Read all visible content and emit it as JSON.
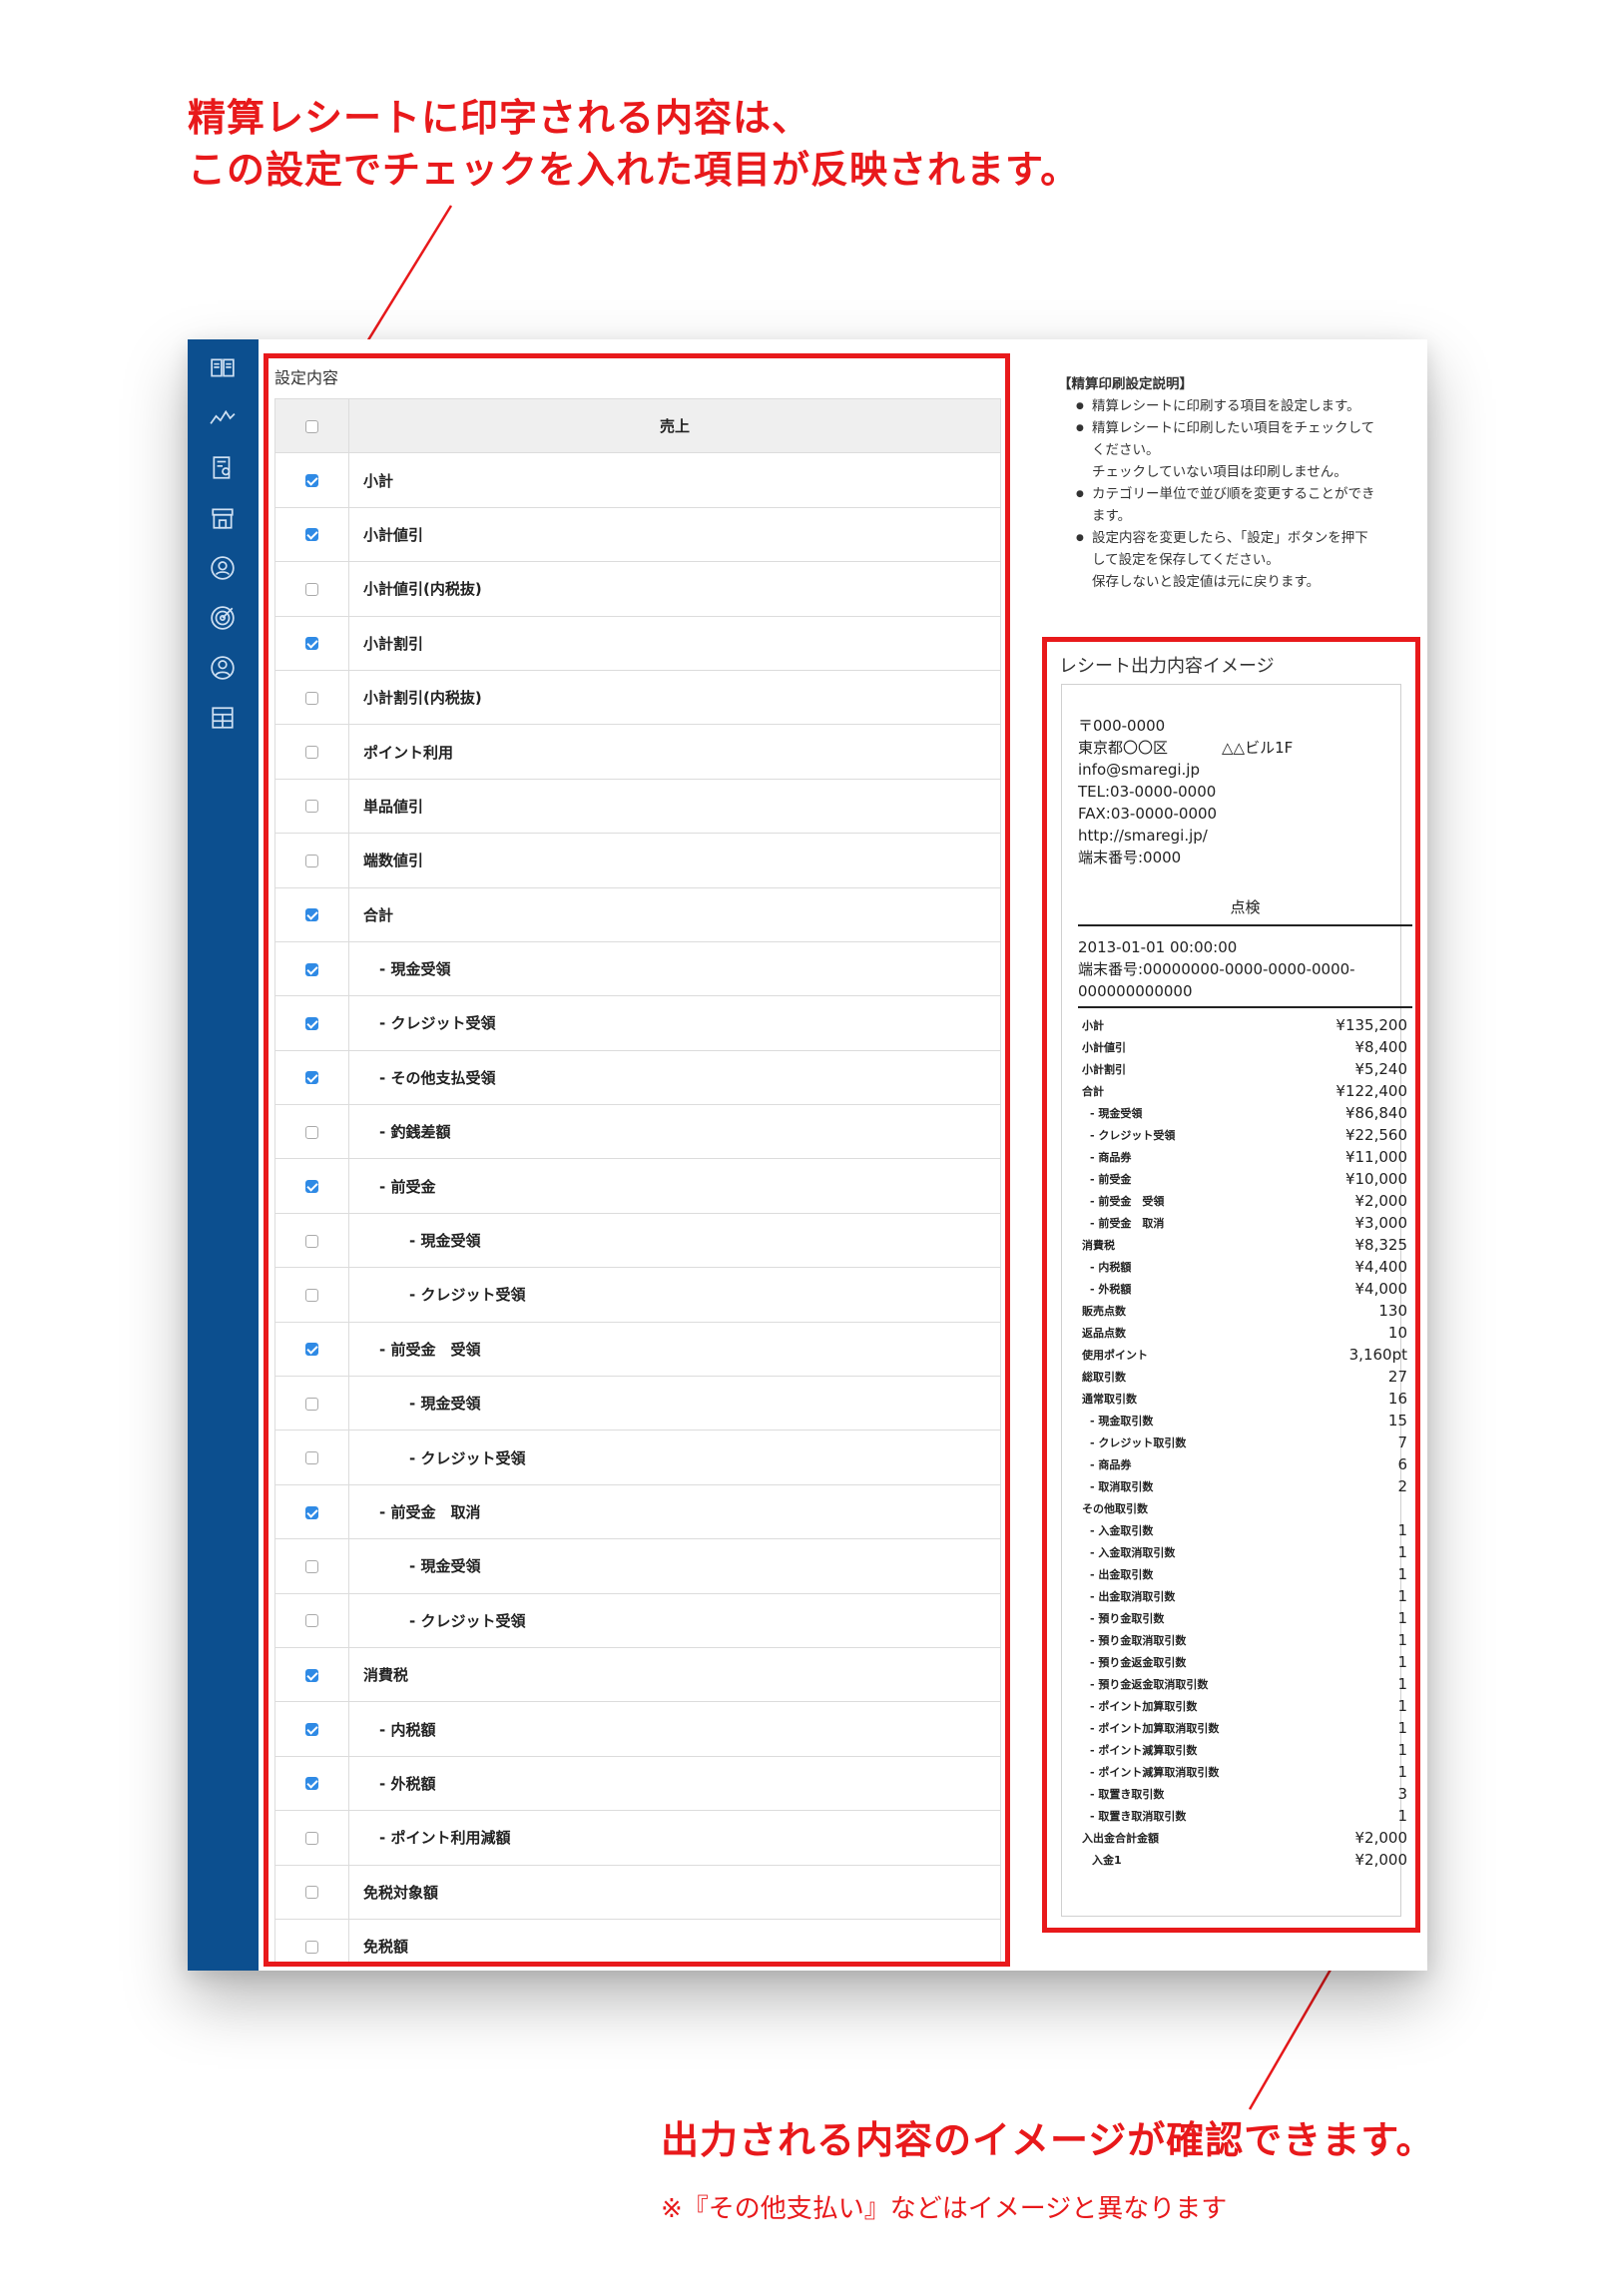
{
  "callouts": {
    "top_line1": "精算レシートに印字される内容は、",
    "top_line2": "この設定でチェックを入れた項目が反映されます。",
    "bottom_line": "出力される内容のイメージが確認できます。",
    "bottom_note": "※『その他支払い』などはイメージと異なります"
  },
  "sidebar": {
    "items": [
      {
        "icon": "book-icon"
      },
      {
        "icon": "chart-icon"
      },
      {
        "icon": "report-icon"
      },
      {
        "icon": "store-icon"
      },
      {
        "icon": "user-circle-icon"
      },
      {
        "icon": "target-icon"
      },
      {
        "icon": "account-icon"
      },
      {
        "icon": "grid-icon"
      }
    ]
  },
  "settings": {
    "title": "設定内容",
    "header": "売上",
    "rows": [
      {
        "label": "小計",
        "checked": true,
        "indent": 0
      },
      {
        "label": "小計値引",
        "checked": true,
        "indent": 0
      },
      {
        "label": "小計値引(内税抜)",
        "checked": false,
        "indent": 0
      },
      {
        "label": "小計割引",
        "checked": true,
        "indent": 0
      },
      {
        "label": "小計割引(内税抜)",
        "checked": false,
        "indent": 0
      },
      {
        "label": "ポイント利用",
        "checked": false,
        "indent": 0
      },
      {
        "label": "単品値引",
        "checked": false,
        "indent": 0
      },
      {
        "label": "端数値引",
        "checked": false,
        "indent": 0
      },
      {
        "label": "合計",
        "checked": true,
        "indent": 0
      },
      {
        "label": "- 現金受領",
        "checked": true,
        "indent": 1
      },
      {
        "label": "- クレジット受領",
        "checked": true,
        "indent": 1
      },
      {
        "label": "- その他支払受領",
        "checked": true,
        "indent": 1
      },
      {
        "label": "- 釣銭差額",
        "checked": false,
        "indent": 1
      },
      {
        "label": "- 前受金",
        "checked": true,
        "indent": 1
      },
      {
        "label": "- 現金受領",
        "checked": false,
        "indent": 2
      },
      {
        "label": "- クレジット受領",
        "checked": false,
        "indent": 2
      },
      {
        "label": "- 前受金　受領",
        "checked": true,
        "indent": 1
      },
      {
        "label": "- 現金受領",
        "checked": false,
        "indent": 2
      },
      {
        "label": "- クレジット受領",
        "checked": false,
        "indent": 2
      },
      {
        "label": "- 前受金　取消",
        "checked": true,
        "indent": 1
      },
      {
        "label": "- 現金受領",
        "checked": false,
        "indent": 2
      },
      {
        "label": "- クレジット受領",
        "checked": false,
        "indent": 2
      },
      {
        "label": "消費税",
        "checked": true,
        "indent": 0
      },
      {
        "label": "- 内税額",
        "checked": true,
        "indent": 1
      },
      {
        "label": "- 外税額",
        "checked": true,
        "indent": 1
      },
      {
        "label": "- ポイント利用減額",
        "checked": false,
        "indent": 1
      },
      {
        "label": "免税対象額",
        "checked": false,
        "indent": 0
      },
      {
        "label": "免税額",
        "checked": false,
        "indent": 0
      }
    ]
  },
  "help": {
    "title": "【精算印刷設定説明】",
    "items": [
      [
        "精算レシートに印刷する項目を設定します。"
      ],
      [
        "精算レシートに印刷したい項目をチェックして",
        "ください。",
        "チェックしていない項目は印刷しません。"
      ],
      [
        "カテゴリー単位で並び順を変更することができ",
        "ます。"
      ],
      [
        "設定内容を変更したら、「設定」ボタンを押下",
        "して設定を保存してください。",
        "保存しないと設定値は元に戻ります。"
      ]
    ]
  },
  "receipt": {
    "title": "レシート出力内容イメージ",
    "zip": "〒000-0000",
    "address1": "東京都〇〇区",
    "address2": "△△ビル1F",
    "email": "info@smaregi.jp",
    "tel": "TEL:03-0000-0000",
    "fax": "FAX:03-0000-0000",
    "url": "http://smaregi.jp/",
    "terminal": "端末番号:0000",
    "heading": "点検",
    "datetime": "2013-01-01 00:00:00",
    "terminal_full_1": "端末番号:00000000-0000-0000-0000-",
    "terminal_full_2": "000000000000",
    "rows": [
      {
        "label": "小計",
        "value": "¥135,200",
        "indent": 0
      },
      {
        "label": "小計値引",
        "value": "¥8,400",
        "indent": 0
      },
      {
        "label": "小計割引",
        "value": "¥5,240",
        "indent": 0
      },
      {
        "label": "合計",
        "value": "¥122,400",
        "indent": 0
      },
      {
        "label": "- 現金受領",
        "value": "¥86,840",
        "indent": 1
      },
      {
        "label": "- クレジット受領",
        "value": "¥22,560",
        "indent": 1
      },
      {
        "label": "- 商品券",
        "value": "¥11,000",
        "indent": 1
      },
      {
        "label": "- 前受金",
        "value": "¥10,000",
        "indent": 1
      },
      {
        "label": "- 前受金　受領",
        "value": "¥2,000",
        "indent": 1
      },
      {
        "label": "- 前受金　取消",
        "value": "¥3,000",
        "indent": 1
      },
      {
        "label": "消費税",
        "value": "¥8,325",
        "indent": 0
      },
      {
        "label": "- 内税額",
        "value": "¥4,400",
        "indent": 1
      },
      {
        "label": "- 外税額",
        "value": "¥4,000",
        "indent": 1
      },
      {
        "label": "販売点数",
        "value": "130",
        "indent": 0
      },
      {
        "label": "返品点数",
        "value": "10",
        "indent": 0
      },
      {
        "label": "使用ポイント",
        "value": "3,160pt",
        "indent": 0
      },
      {
        "label": "総取引数",
        "value": "27",
        "indent": 0
      },
      {
        "label": "通常取引数",
        "value": "16",
        "indent": 0
      },
      {
        "label": "- 現金取引数",
        "value": "15",
        "indent": 1
      },
      {
        "label": "- クレジット取引数",
        "value": "7",
        "indent": 1
      },
      {
        "label": "- 商品券",
        "value": "6",
        "indent": 1
      },
      {
        "label": "- 取消取引数",
        "value": "2",
        "indent": 1
      },
      {
        "label": "その他取引数",
        "value": "",
        "indent": 0
      },
      {
        "label": "- 入金取引数",
        "value": "1",
        "indent": 1
      },
      {
        "label": "- 入金取消取引数",
        "value": "1",
        "indent": 1
      },
      {
        "label": "- 出金取引数",
        "value": "1",
        "indent": 1
      },
      {
        "label": "- 出金取消取引数",
        "value": "1",
        "indent": 1
      },
      {
        "label": "- 預り金取引数",
        "value": "1",
        "indent": 1
      },
      {
        "label": "- 預り金取消取引数",
        "value": "1",
        "indent": 1
      },
      {
        "label": "- 預り金返金取引数",
        "value": "1",
        "indent": 1
      },
      {
        "label": "- 預り金返金取消取引数",
        "value": "1",
        "indent": 1
      },
      {
        "label": "- ポイント加算取引数",
        "value": "1",
        "indent": 1
      },
      {
        "label": "- ポイント加算取消取引数",
        "value": "1",
        "indent": 1
      },
      {
        "label": "- ポイント減算取引数",
        "value": "1",
        "indent": 1
      },
      {
        "label": "- ポイント減算取消取引数",
        "value": "1",
        "indent": 1
      },
      {
        "label": "- 取置き取引数",
        "value": "3",
        "indent": 1
      },
      {
        "label": "- 取置き取消取引数",
        "value": "1",
        "indent": 1
      },
      {
        "label": "入出金合計金額",
        "value": "¥2,000",
        "indent": 0
      },
      {
        "label": "入金1",
        "value": "¥2,000",
        "indent": 2
      }
    ]
  }
}
